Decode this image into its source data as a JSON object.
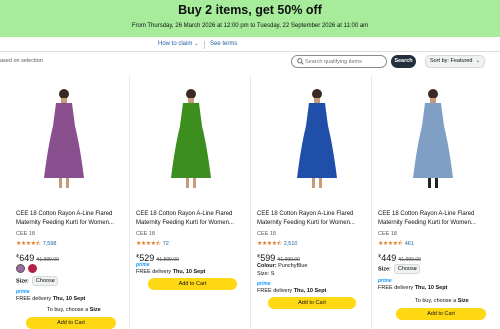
{
  "banner": {
    "headline": "Buy 2 items, get 50% off",
    "dates": "From Thursday, 26 March 2026 at 12:00 pm to Tuesday, 22 September 2026 at 11:00 am"
  },
  "links": {
    "how_to_claim": "How to claim",
    "see_terms": "See terms"
  },
  "toolbar": {
    "based_on": "ased on selection",
    "search_placeholder": "Search qualifying items",
    "search_button": "Search",
    "sort_label": "Sort by: Featured"
  },
  "colors": {
    "banner": "#a6ec9a",
    "add_to_cart": "#ffd814",
    "link": "#2162a1",
    "stars": "#de7921",
    "prime": "#1399ff"
  },
  "products": [
    {
      "title_line1": "CEE 18 Cotton Rayon A-Line Flared",
      "title_line2": "Maternity Feeding Kurti for Women...",
      "brand": "CEE 18",
      "stars": "★★★★⯪",
      "rating_count": "7,598",
      "currency": "₹",
      "price": "649",
      "mrp": "₹1,999.00",
      "size_label": "Size:",
      "size_select": "Choose",
      "prime": "prime",
      "delivery_prefix": "FREE delivery",
      "delivery_date": "Thu, 10 Sept",
      "to_buy_prefix": "To buy, choose a",
      "to_buy_strong": "Size",
      "add_to_cart": "Add to Cart",
      "dress_color": "#8a4f8e",
      "swatches": [
        "#9c6ba0",
        "#b3204a"
      ]
    },
    {
      "title_line1": "CEE 18 Cotton Rayon A-Line Flared",
      "title_line2": "Maternity Feeding Kurti for Women...",
      "brand": "CEE 18",
      "stars": "★★★★⯪",
      "rating_count": "72",
      "currency": "₹",
      "price": "529",
      "mrp": "₹1,599.00",
      "prime": "prime",
      "delivery_prefix": "FREE delivery",
      "delivery_date": "Thu, 10 Sept",
      "add_to_cart": "Add to Cart",
      "dress_color": "#3c8f1e"
    },
    {
      "title_line1": "CEE 18 Cotton Rayon A-Line Flared",
      "title_line2": "Maternity Feeding Kurti for Women...",
      "brand": "CEE 18",
      "stars": "★★★★⯪",
      "rating_count": "2,510",
      "currency": "₹",
      "price": "599",
      "mrp": "₹1,999.00",
      "colour_label": "Colour:",
      "colour_value": "PunchyBlue",
      "size_text": "Size: S",
      "prime": "prime",
      "delivery_prefix": "FREE delivery",
      "delivery_date": "Thu, 10 Sept",
      "add_to_cart": "Add to Cart",
      "dress_color": "#1f4fa8"
    },
    {
      "title_line1": "CEE 18 Cotton Rayon A-Line Flared",
      "title_line2": "Maternity Feeding Kurti for Women...",
      "brand": "CEE 18",
      "stars": "★★★★⯪",
      "rating_count": "461",
      "currency": "₹",
      "price": "449",
      "mrp": "₹1,999.00",
      "size_label": "Size:",
      "size_select": "Choose",
      "prime": "prime",
      "delivery_prefix": "FREE delivery",
      "delivery_date": "Thu, 10 Sept",
      "to_buy_prefix": "To buy, choose a",
      "to_buy_strong": "Size",
      "add_to_cart": "Add to Cart",
      "dress_color": "#7f9fc4"
    }
  ]
}
